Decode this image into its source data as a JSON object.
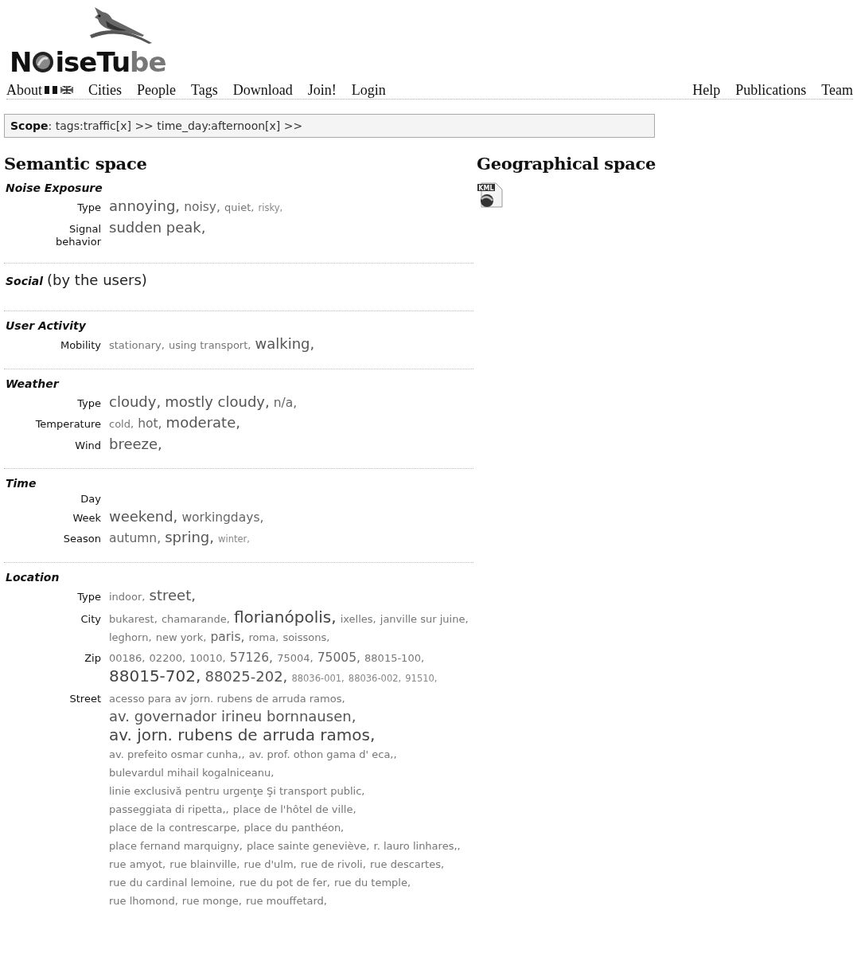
{
  "logo": [
    "N",
    "iseTu",
    "be"
  ],
  "nav": {
    "left": [
      {
        "label": "About",
        "flags": [
          {
            "kind": "plain"
          },
          {
            "kind": "plain"
          },
          {
            "kind": "union-jack"
          }
        ]
      },
      {
        "label": "Cities"
      },
      {
        "label": "People"
      },
      {
        "label": "Tags"
      },
      {
        "label": "Download"
      },
      {
        "label": "Join!"
      },
      {
        "label": "Login"
      }
    ],
    "right": [
      {
        "label": "Help"
      },
      {
        "label": "Publications"
      },
      {
        "label": "Team"
      }
    ]
  },
  "scope": "**Scope**: tags:traffic[x] >> time_day:afternoon[x] >>",
  "semantic": {
    "title": "Semantic space",
    "sections": [
      {
        "title": "Noise Exposure",
        "rows": [
          {
            "label": "Type",
            "tags": [
              {
                "text": "annoying,",
                "kind": "l"
              },
              {
                "text": "noisy,",
                "kind": "m"
              },
              {
                "text": "quiet,",
                "kind": "s"
              },
              {
                "text": "risky,",
                "kind": "xs"
              }
            ]
          },
          {
            "label": "Signal behavior",
            "tags": [
              {
                "text": "sudden peak,",
                "kind": "l"
              }
            ]
          }
        ]
      },
      {
        "title": "Social",
        "note": "(by the users)"
      },
      {
        "title": "User Activity",
        "rows": [
          {
            "label": "Mobility",
            "tags": [
              {
                "text": "stationary,",
                "kind": "s"
              },
              {
                "text": "using transport,",
                "kind": "s"
              },
              {
                "text": "walking,",
                "kind": "l"
              }
            ]
          }
        ]
      },
      {
        "title": "Weather",
        "rows": [
          {
            "label": "Type",
            "tags": [
              {
                "text": "cloudy,",
                "kind": "l"
              },
              {
                "text": "mostly cloudy,",
                "kind": "l"
              },
              {
                "text": "n/a,",
                "kind": "m"
              }
            ]
          },
          {
            "label": "Temperature",
            "tags": [
              {
                "text": "cold,",
                "kind": "s"
              },
              {
                "text": "hot,",
                "kind": "m"
              },
              {
                "text": "moderate,",
                "kind": "l"
              }
            ]
          },
          {
            "label": "Wind",
            "tags": [
              {
                "text": "breeze,",
                "kind": "l"
              }
            ]
          }
        ]
      },
      {
        "title": "Time",
        "rows": [
          {
            "label": "Day"
          },
          {
            "label": "Week",
            "tags": [
              {
                "text": "weekend,",
                "kind": "l"
              },
              {
                "text": "workingdays,",
                "kind": "m"
              }
            ]
          },
          {
            "label": "Season",
            "tags": [
              {
                "text": "autumn,",
                "kind": "m"
              },
              {
                "text": "spring,",
                "kind": "l"
              },
              {
                "text": "winter,",
                "kind": "xs"
              }
            ]
          }
        ]
      },
      {
        "title": "Location",
        "rows": [
          {
            "label": "Type",
            "tags": [
              {
                "text": "indoor,",
                "kind": "s"
              },
              {
                "text": "street,",
                "kind": "l"
              }
            ]
          },
          {
            "label": "City",
            "tags": [
              {
                "text": "bukarest,",
                "kind": "s"
              },
              {
                "text": "chamarande,",
                "kind": "s"
              },
              {
                "text": "florianópolis,",
                "kind": "xl"
              },
              {
                "text": "ixelles,",
                "kind": "s"
              },
              {
                "text": "janville sur juine,",
                "kind": "s"
              },
              {
                "text": "leghorn,",
                "kind": "s"
              },
              {
                "text": "new york,",
                "kind": "s"
              },
              {
                "text": "paris,",
                "kind": "m"
              },
              {
                "text": "roma,",
                "kind": "s"
              },
              {
                "text": "soissons,",
                "kind": "s"
              }
            ]
          },
          {
            "label": "Zip",
            "tags": [
              {
                "text": "00186,",
                "kind": "s"
              },
              {
                "text": "02200,",
                "kind": "s"
              },
              {
                "text": "10010,",
                "kind": "s"
              },
              {
                "text": "57126,",
                "kind": "m"
              },
              {
                "text": "75004,",
                "kind": "s"
              },
              {
                "text": "75005,",
                "kind": "m"
              },
              {
                "text": "88015-100,",
                "kind": "s"
              },
              {
                "text": "88015-702,",
                "kind": "xl"
              },
              {
                "text": "88025-202,",
                "kind": "l"
              },
              {
                "text": "88036-001,",
                "kind": "xs"
              },
              {
                "text": "88036-002,",
                "kind": "xs"
              },
              {
                "text": "91510,",
                "kind": "xs"
              }
            ]
          },
          {
            "label": "Street",
            "tags": [
              {
                "text": "acesso para av jorn. rubens de arruda ramos,",
                "kind": "s"
              },
              {
                "text": "av. governador irineu bornnausen,",
                "kind": "l"
              },
              {
                "text": "av. jorn. rubens de arruda ramos,",
                "kind": "xl"
              },
              {
                "text": "av. prefeito osmar cunha,,",
                "kind": "s"
              },
              {
                "text": "av. prof. othon gama d' eca,,",
                "kind": "s"
              },
              {
                "text": "bulevardul mihail kogalniceanu,",
                "kind": "s"
              },
              {
                "text": "linie exclusivă pentru urgenţe Şi transport public,",
                "kind": "s"
              },
              {
                "text": "passeggiata di ripetta,,",
                "kind": "s"
              },
              {
                "text": "place de l'hôtel de ville,",
                "kind": "s"
              },
              {
                "text": "place de la contrescarpe,",
                "kind": "s"
              },
              {
                "text": "place du panthéon,",
                "kind": "s"
              },
              {
                "text": "place fernand marquigny,",
                "kind": "s"
              },
              {
                "text": "place sainte geneviève,",
                "kind": "s"
              },
              {
                "text": "r. lauro linhares,,",
                "kind": "s"
              },
              {
                "text": "rue amyot,",
                "kind": "s"
              },
              {
                "text": "rue blainville,",
                "kind": "s"
              },
              {
                "text": "rue d'ulm,",
                "kind": "s"
              },
              {
                "text": "rue de rivoli,",
                "kind": "s"
              },
              {
                "text": "rue descartes,",
                "kind": "s"
              },
              {
                "text": "rue du cardinal lemoine,",
                "kind": "s"
              },
              {
                "text": "rue du pot de fer,",
                "kind": "s"
              },
              {
                "text": "rue du temple,",
                "kind": "s"
              },
              {
                "text": "rue lhomond,",
                "kind": "s"
              },
              {
                "text": "rue monge,",
                "kind": "s"
              },
              {
                "text": "rue mouffetard,",
                "kind": "s"
              }
            ]
          }
        ]
      }
    ]
  },
  "geo": {
    "title": "Geographical space",
    "kml_label": "KML"
  }
}
